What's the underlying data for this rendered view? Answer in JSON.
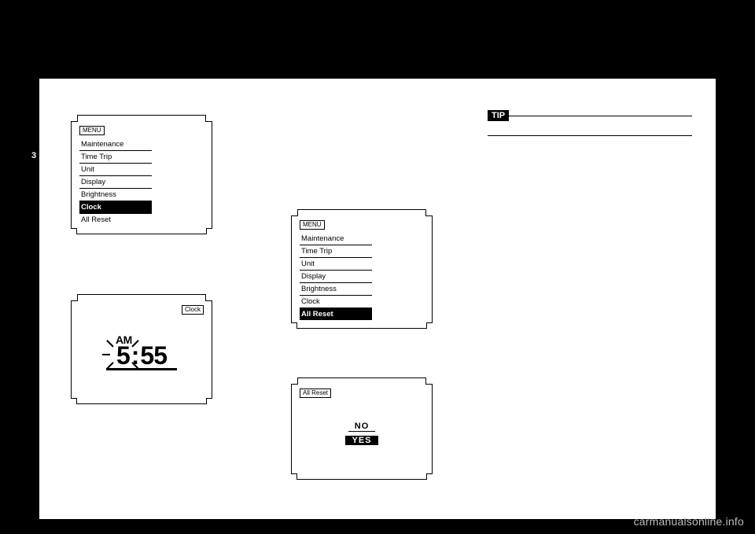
{
  "tab": "3",
  "watermark": "carmanualsonline.info",
  "screens": {
    "menu_clock": {
      "title": "MENU",
      "items": [
        "Maintenance",
        "Time Trip",
        "Unit",
        "Display",
        "Brightness",
        "Clock",
        "All Reset"
      ],
      "selected": "Clock"
    },
    "clock_set": {
      "title": "Clock",
      "ampm": "AM",
      "hour": "5",
      "minute": "55"
    },
    "menu_allreset": {
      "title": "MENU",
      "items": [
        "Maintenance",
        "Time Trip",
        "Unit",
        "Display",
        "Brightness",
        "Clock",
        "All Reset"
      ],
      "selected": "All Reset"
    },
    "all_reset_confirm": {
      "title": "All Reset",
      "options": [
        "NO",
        "YES"
      ],
      "selected": "YES"
    }
  },
  "tip": {
    "label": "TIP"
  }
}
